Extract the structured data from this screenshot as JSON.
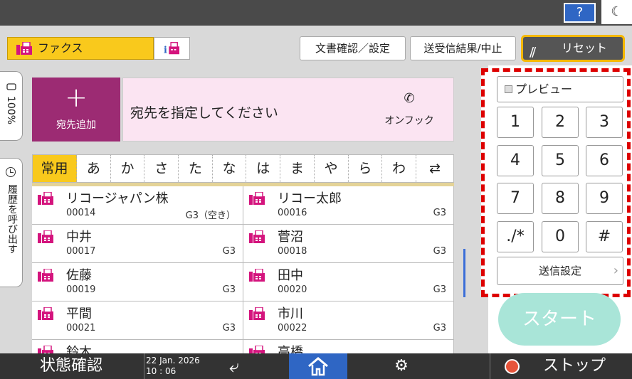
{
  "header": {
    "help_label": "?",
    "night_icon": "moon-icon",
    "fax_tab_label": "ファクス",
    "doc_confirm_label": "文書確認／設定",
    "result_label": "送受信結果/中止",
    "reset_label": "リセット"
  },
  "side_tabs": {
    "zoom_label": "100%",
    "history_label": "履歴を呼び出す"
  },
  "destination": {
    "add_label": "宛先追加",
    "add_symbol": "+",
    "prompt": "宛先を指定してください",
    "onhook_label": "オンフック"
  },
  "index_tabs": [
    "常用",
    "あ",
    "か",
    "さ",
    "た",
    "な",
    "は",
    "ま",
    "や",
    "ら",
    "わ"
  ],
  "address_list": [
    {
      "name": "リコージャパン株",
      "number": "00014",
      "line": "G3（空き）"
    },
    {
      "name": "リコー太郎",
      "number": "00016",
      "line": "G3"
    },
    {
      "name": "中井",
      "number": "00017",
      "line": "G3"
    },
    {
      "name": "菅沼",
      "number": "00018",
      "line": "G3"
    },
    {
      "name": "佐藤",
      "number": "00019",
      "line": "G3"
    },
    {
      "name": "田中",
      "number": "00020",
      "line": "G3"
    },
    {
      "name": "平間",
      "number": "00021",
      "line": "G3"
    },
    {
      "name": "市川",
      "number": "00022",
      "line": "G3"
    },
    {
      "name": "鈴木",
      "number": "",
      "line": ""
    },
    {
      "name": "高橋",
      "number": "",
      "line": ""
    }
  ],
  "keypad": {
    "preview_label": "プレビュー",
    "keys": [
      "1",
      "2",
      "3",
      "4",
      "5",
      "6",
      "7",
      "8",
      "9",
      "./*",
      "0",
      "#"
    ],
    "send_settings_label": "送信設定",
    "start_label": "スタート"
  },
  "footer": {
    "status_label": "状態確認",
    "date": "22 Jan. 2026",
    "time": "10 : 06",
    "stop_label": "ストップ"
  },
  "colors": {
    "fax_yellow": "#f9c91c",
    "fax_magenta": "#d4147d",
    "add_dest": "#9c2b73",
    "highlight_red": "#dd0000",
    "start_teal": "#a9e5d8",
    "home_blue": "#2f66c4"
  }
}
